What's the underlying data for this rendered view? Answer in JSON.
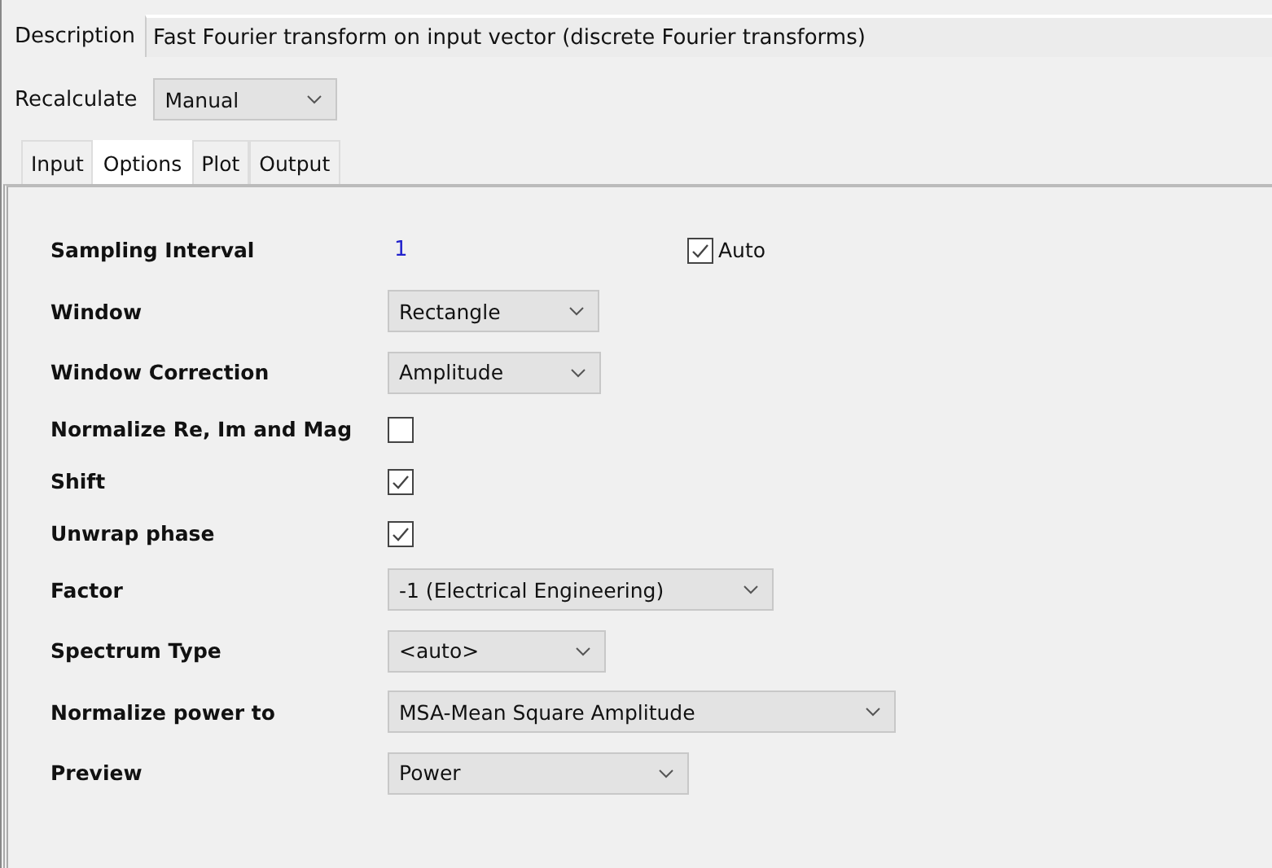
{
  "description": {
    "label": "Description",
    "value": "Fast Fourier transform on input vector (discrete Fourier transforms)"
  },
  "recalculate": {
    "label": "Recalculate",
    "value": "Manual"
  },
  "tabs": [
    {
      "label": "Input",
      "selected": false
    },
    {
      "label": "Options",
      "selected": true
    },
    {
      "label": "Plot",
      "selected": false
    },
    {
      "label": "Output",
      "selected": false
    }
  ],
  "options": [
    {
      "kind": "value",
      "label": "Sampling Interval",
      "value": "1",
      "extra": {
        "label": "Auto",
        "checked": true
      }
    },
    {
      "kind": "dropdown",
      "label": "Window",
      "value": "Rectangle"
    },
    {
      "kind": "dropdown",
      "label": "Window Correction",
      "value": "Amplitude"
    },
    {
      "kind": "checkbox",
      "label": "Normalize Re, Im and Mag",
      "checked": false
    },
    {
      "kind": "checkbox",
      "label": "Shift",
      "checked": true
    },
    {
      "kind": "checkbox",
      "label": "Unwrap phase",
      "checked": true
    },
    {
      "kind": "dropdown",
      "label": "Factor",
      "value": "-1 (Electrical Engineering)"
    },
    {
      "kind": "dropdown",
      "label": "Spectrum Type",
      "value": "<auto>"
    },
    {
      "kind": "dropdown",
      "label": "Normalize power to",
      "value": "MSA-Mean Square Amplitude"
    },
    {
      "kind": "dropdown",
      "label": "Preview",
      "value": "Power"
    }
  ]
}
